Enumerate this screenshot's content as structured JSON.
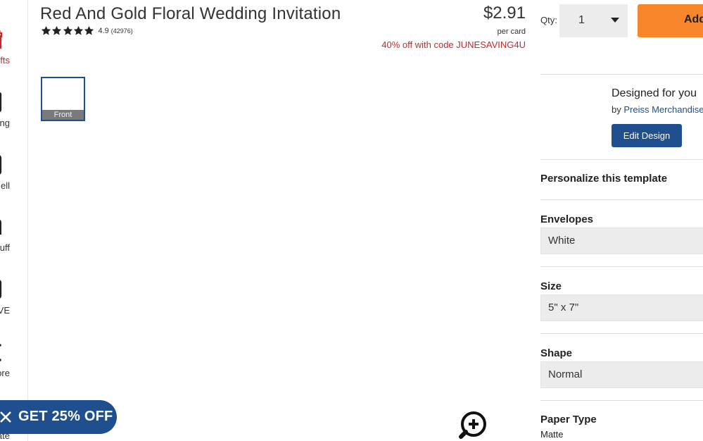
{
  "product": {
    "title": "Red And Gold Floral Wedding Invitation",
    "rating_value": "4.9",
    "rating_count": "(42976)",
    "stars": 5,
    "price": "$2.91",
    "price_unit": "per card",
    "promo": "40% off with code JUNESAVING4U"
  },
  "rail": {
    "items": [
      {
        "label": "fts",
        "icon": "gift-icon"
      },
      {
        "label": "ding",
        "icon": "heart-card-icon"
      },
      {
        "label": "ell",
        "icon": "dollar-icon"
      },
      {
        "label": "Stuff",
        "icon": "hands-icon"
      },
      {
        "label": "VE",
        "icon": "face-icon"
      },
      {
        "label": "lore",
        "icon": "explore-icon"
      },
      {
        "label": "eate",
        "icon": "create-icon"
      }
    ]
  },
  "thumbnail": {
    "label": "Front"
  },
  "promo_pill": {
    "text": "GET 25% OFF"
  },
  "purchase": {
    "qty_label": "Qty:",
    "qty_value": "1",
    "add_label": "Add"
  },
  "designer": {
    "title": "Designed for you",
    "by": "by",
    "name": "Preiss Merchandise",
    "edit_label": "Edit Design"
  },
  "options": {
    "personalize_title": "Personalize this template",
    "envelopes": {
      "label": "Envelopes",
      "value": "White"
    },
    "size": {
      "label": "Size",
      "value": "5\" x 7\""
    },
    "shape": {
      "label": "Shape",
      "value": "Normal"
    },
    "paper": {
      "label": "Paper Type",
      "value": "Matte"
    }
  },
  "colors": {
    "accent_blue": "#1f4f8f",
    "add_orange": "#f8862a",
    "promo_red": "#c62828"
  }
}
